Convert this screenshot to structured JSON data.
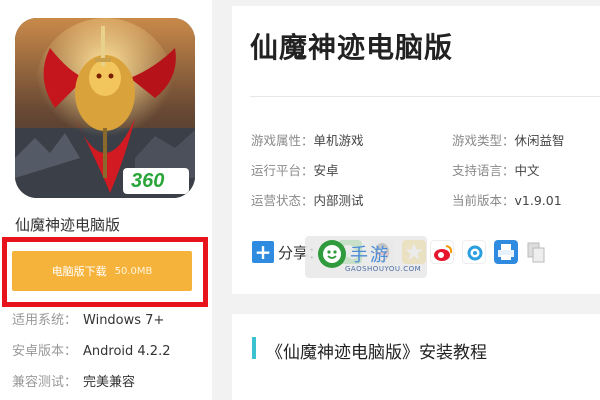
{
  "app": {
    "name": "仙魔神迹电脑版",
    "icon_badge": "360"
  },
  "download": {
    "label": "电脑版下载",
    "size": "50.0MB"
  },
  "specs": [
    {
      "key": "适用系统：",
      "value": "Windows 7+"
    },
    {
      "key": "安卓版本：",
      "value": "Android 4.2.2"
    },
    {
      "key": "兼容测试：",
      "value": "完美兼容"
    }
  ],
  "info": {
    "title": "仙魔神迹电脑版",
    "rows": [
      {
        "k1": "游戏属性：",
        "v1": "单机游戏",
        "k2": "游戏类型：",
        "v2": "休闲益智"
      },
      {
        "k1": "运行平台：",
        "v1": "安卓",
        "k2": "支持语言：",
        "v2": "中文"
      },
      {
        "k1": "运营状态：",
        "v1": "内部测试",
        "k2": "当前版本：",
        "v2": "v1.9.01"
      }
    ]
  },
  "share": {
    "label": "分享：",
    "icons": [
      "wechat-icon",
      "qq-icon",
      "qzone-icon",
      "weibo-icon",
      "tencent-weibo-icon",
      "print-icon",
      "copy-icon"
    ]
  },
  "watermark": {
    "text": "手游",
    "url": "GAOSHOUYOU.COM"
  },
  "section": {
    "title": "《仙魔神迹电脑版》安装教程"
  },
  "colors": {
    "download_button": "#f6b33c",
    "highlight_frame": "#e8141b",
    "accent": "#3cc2cf",
    "share_plus": "#2e8be0"
  }
}
